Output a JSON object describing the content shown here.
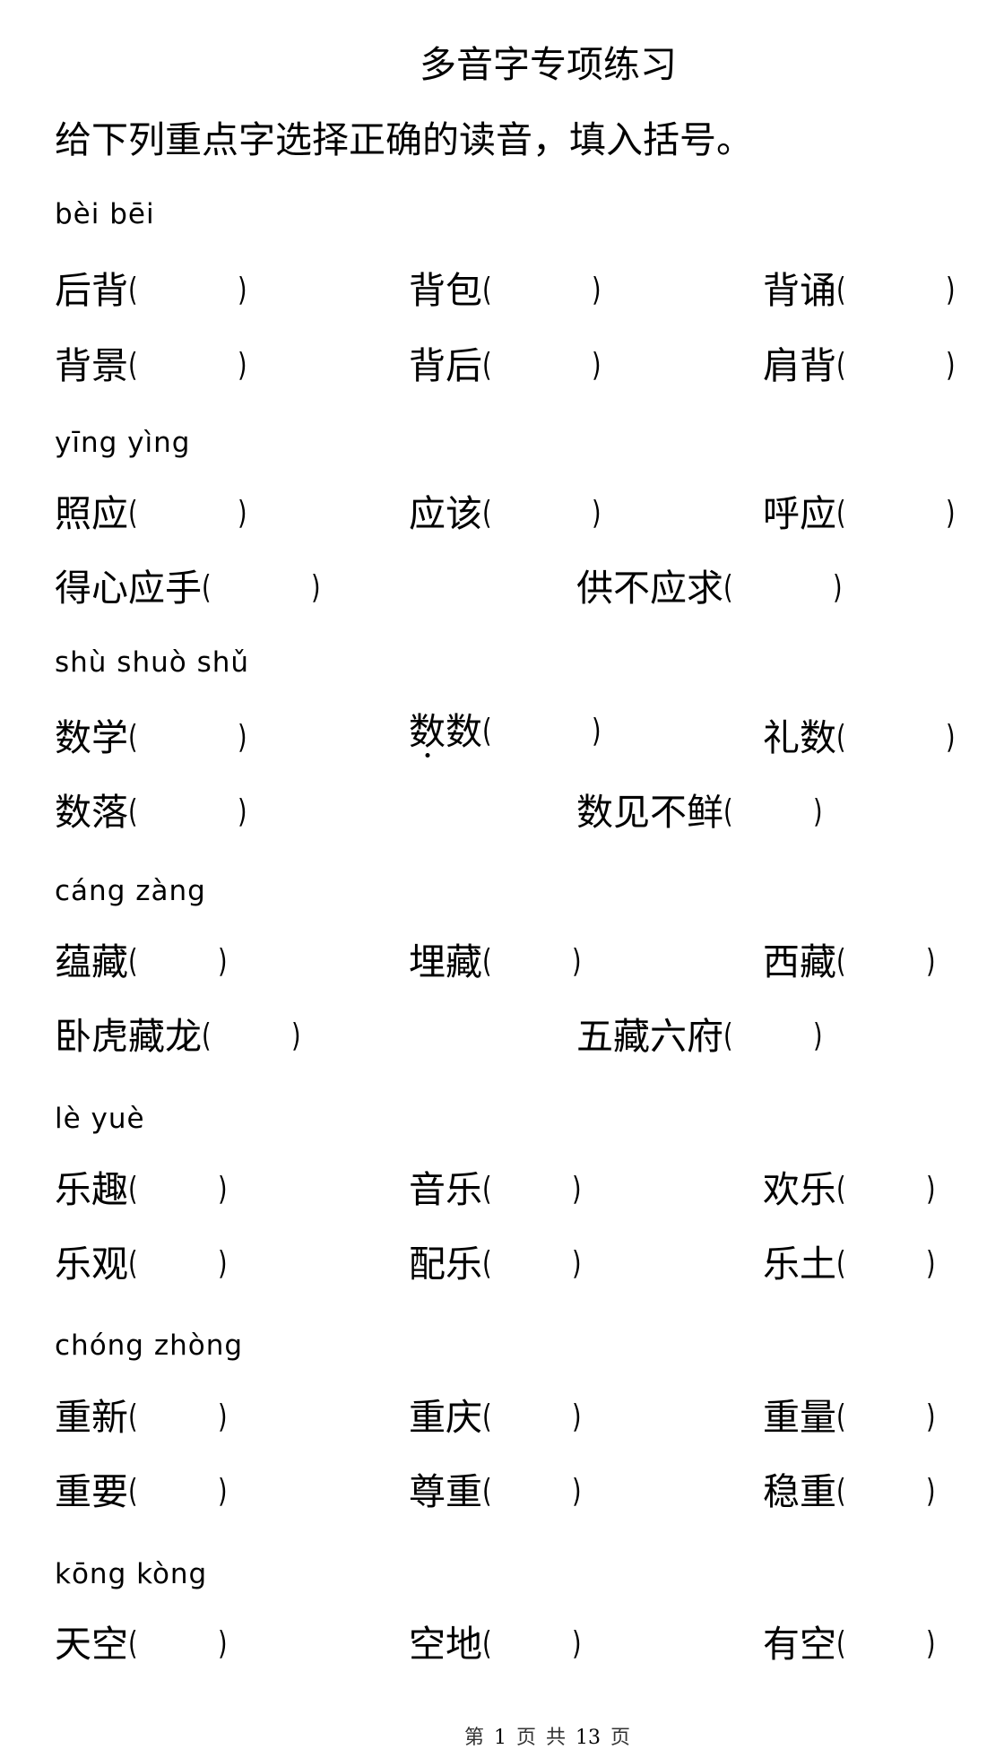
{
  "title": "多音字专项练习",
  "instruction": "给下列重点字选择正确的读音，填入括号。",
  "paren_open": "(",
  "paren_close": ")",
  "sections": [
    {
      "pinyin": "bèi   bēi",
      "rows": [
        [
          "后背",
          "背包",
          "背诵"
        ],
        [
          "背景",
          "背后",
          "肩背"
        ]
      ]
    },
    {
      "pinyin": "yīng   yìng",
      "rows": [
        [
          "照应",
          "应该",
          "呼应"
        ],
        [
          "得心应手",
          "供不应求"
        ]
      ]
    },
    {
      "pinyin": "shù   shuò   shǔ",
      "rows": [
        [
          "数学",
          "数数",
          "礼数"
        ],
        [
          "数落",
          "数见不鲜"
        ]
      ],
      "emphasis_note": "第一个“数”字下方有着重点"
    },
    {
      "pinyin": "cáng    zàng",
      "rows": [
        [
          "蕴藏",
          "埋藏",
          "西藏"
        ],
        [
          "卧虎藏龙",
          "五藏六府"
        ]
      ]
    },
    {
      "pinyin": "lè    yuè",
      "rows": [
        [
          "乐趣",
          "音乐",
          "欢乐"
        ],
        [
          "乐观",
          "配乐",
          "乐土"
        ]
      ]
    },
    {
      "pinyin": "chóng    zhòng",
      "rows": [
        [
          "重新",
          "重庆",
          "重量"
        ],
        [
          "重要",
          "尊重",
          "稳重"
        ]
      ]
    },
    {
      "pinyin": "kōng    kòng",
      "rows": [
        [
          "天空",
          "空地",
          "有空"
        ]
      ]
    }
  ],
  "footer": {
    "prefix": "第",
    "current_page": "1",
    "mid": "页 共",
    "total_pages": "13",
    "suffix": "页"
  }
}
